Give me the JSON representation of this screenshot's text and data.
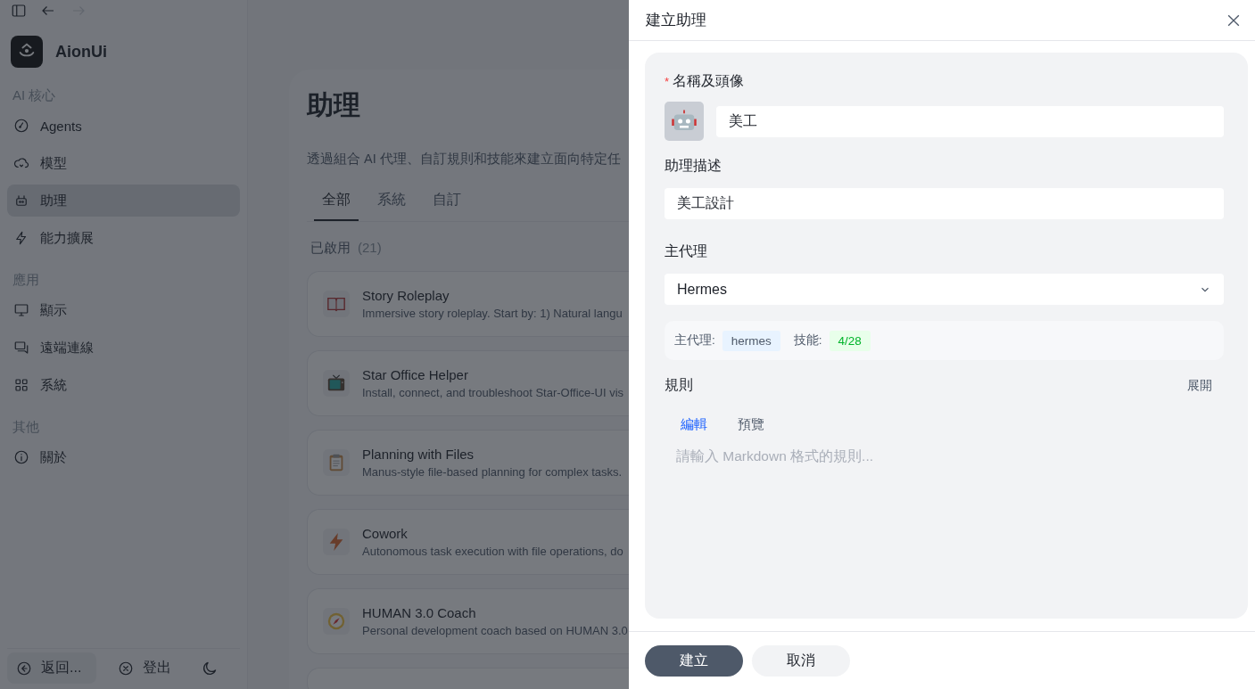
{
  "nav": [
    {
      "kind": "sidebar"
    },
    {
      "kind": "back",
      "disabled": false
    },
    {
      "kind": "forward",
      "disabled": true
    }
  ],
  "app": {
    "name": "AionUi"
  },
  "sidebar": {
    "sections": [
      {
        "title": "AI 核心",
        "items": [
          {
            "label": "Agents",
            "kind": "gauge",
            "selected": false
          },
          {
            "label": "模型",
            "kind": "cloud",
            "selected": false
          },
          {
            "label": "助理",
            "kind": "robot",
            "selected": true
          },
          {
            "label": "能力擴展",
            "kind": "bolt",
            "selected": false
          }
        ]
      },
      {
        "title": "應用",
        "items": [
          {
            "label": "顯示",
            "kind": "monitor",
            "selected": false
          },
          {
            "label": "遠端連線",
            "kind": "chat",
            "selected": false
          },
          {
            "label": "系統",
            "kind": "grid",
            "selected": false
          }
        ]
      },
      {
        "title": "其他",
        "items": [
          {
            "label": "關於",
            "kind": "info",
            "selected": false
          }
        ]
      }
    ],
    "footer": [
      {
        "label": "返回...",
        "kind": "back"
      },
      {
        "label": "登出",
        "kind": "logout"
      }
    ]
  },
  "page": {
    "title": "助理",
    "description": "透過組合 AI 代理、自訂規則和技能來建立面向特定任",
    "tabs": [
      {
        "label": "全部",
        "selected": true
      },
      {
        "label": "系統",
        "selected": false
      },
      {
        "label": "自訂",
        "selected": false
      }
    ],
    "group": {
      "label": "已啟用",
      "count": "(21)"
    },
    "cards": [
      {
        "kind": "book",
        "title": "Story Roleplay",
        "description": "Immersive story roleplay. Start by: 1) Natural langu"
      },
      {
        "kind": "tv",
        "title": "Star Office Helper",
        "description": "Install, connect, and troubleshoot Star-Office-UI vis"
      },
      {
        "kind": "clipboard",
        "title": "Planning with Files",
        "description": "Manus-style file-based planning for complex tasks."
      },
      {
        "kind": "bolt",
        "title": "Cowork",
        "description": "Autonomous task execution with file operations, do"
      },
      {
        "kind": "compass",
        "title": "HUMAN 3.0 Coach",
        "description": "Personal development coach based on HUMAN 3.0"
      }
    ]
  },
  "drawer": {
    "title": "建立助理",
    "name_label": {
      "text": "名稱及頭像",
      "required_mark": "*"
    },
    "name_value": "美工",
    "description_label": "助理描述",
    "description_value": "美工設計",
    "agent_label": "主代理",
    "agent_value": "Hermes",
    "summary": [
      {
        "label": "主代理:",
        "tag": "hermes",
        "kind": "agent"
      },
      {
        "label": "技能:",
        "tag": "4/28",
        "kind": "skills"
      }
    ],
    "rules_label": "規則",
    "expand": "展開",
    "rules_tabs": [
      {
        "label": "編輯",
        "selected": true
      },
      {
        "label": "預覽",
        "selected": false
      }
    ],
    "rules_placeholder": "請輸入 Markdown 格式的規則...",
    "buttons": [
      {
        "label": "建立",
        "kind": "primary"
      },
      {
        "label": "取消",
        "kind": "secondary"
      }
    ]
  }
}
